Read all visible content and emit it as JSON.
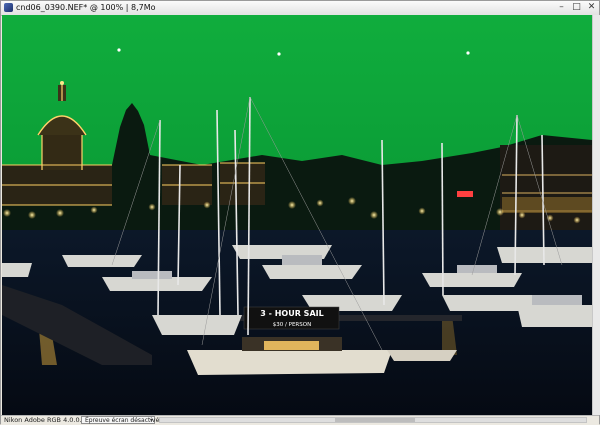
{
  "window": {
    "title": "cnd06_0390.NEF* @ 100% | 8,7Mo",
    "buttons": {
      "minimize": "–",
      "maximize": "□",
      "close": "✕"
    }
  },
  "photo": {
    "sign_text": "3 - HOUR SAIL",
    "sign_subtext": "$30 / PERSON",
    "sky_color": "#0fa83b",
    "water_color": "#08111f",
    "light_color": "#ffd36b"
  },
  "status": {
    "profile": "Nikon Adobe RGB 4.0.0.3000",
    "proof_select": "Épreuve écran désactivée"
  }
}
